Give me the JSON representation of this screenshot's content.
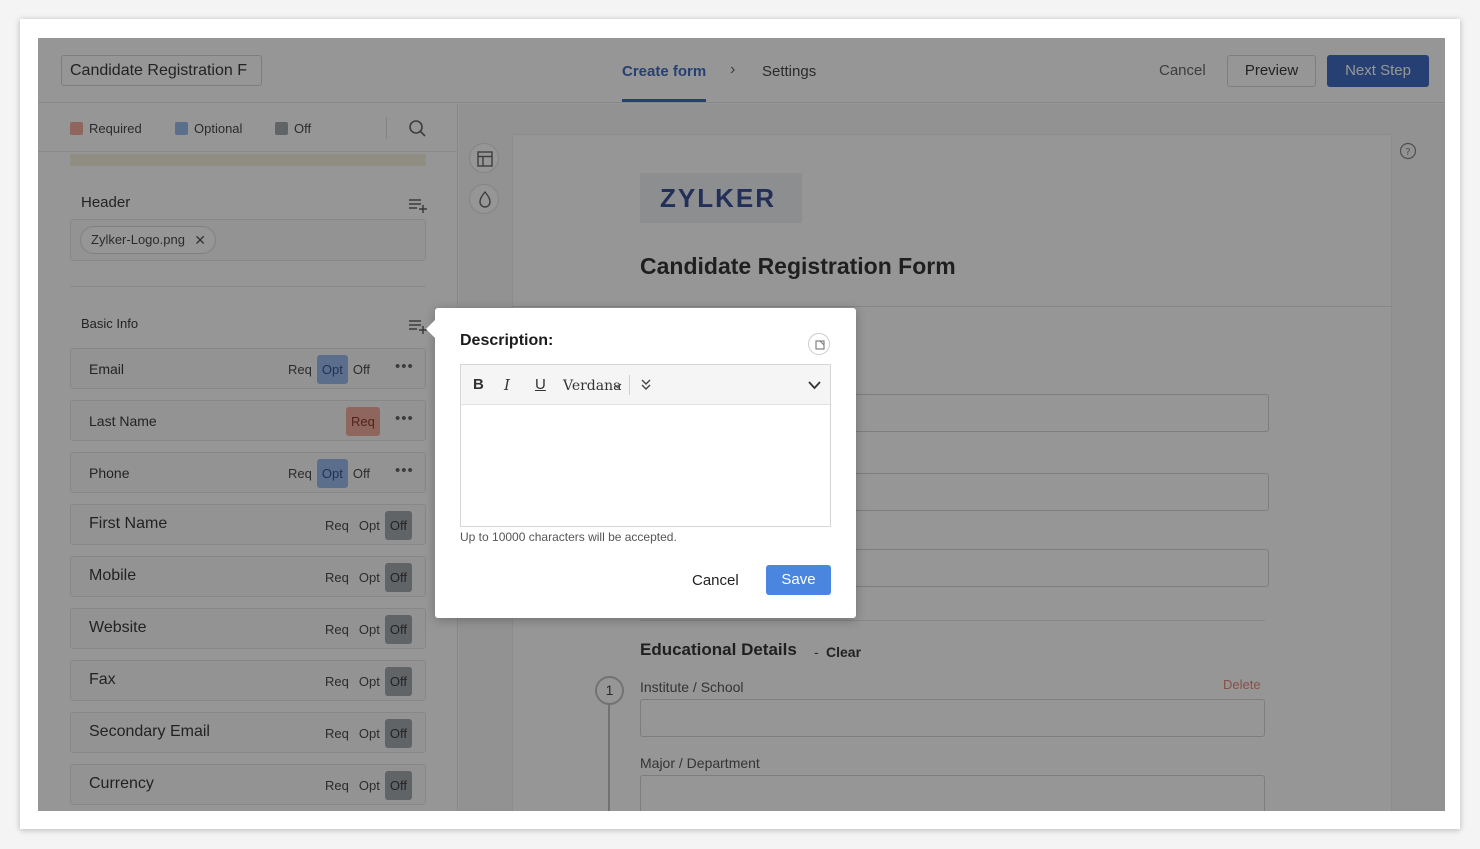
{
  "topbar": {
    "form_name": "Candidate Registration F",
    "step_create": "Create form",
    "step_chevron": "›",
    "step_settings": "Settings",
    "cancel_label": "Cancel",
    "preview_label": "Preview",
    "next_label": "Next Step"
  },
  "legend": {
    "required": "Required",
    "optional": "Optional",
    "off": "Off",
    "colors": {
      "required": "#f1a492",
      "optional": "#8eb3ec",
      "off": "#9aa0a6"
    }
  },
  "header_section": {
    "title": "Header",
    "chip": "Zylker-Logo.png",
    "chip_remove": "✕"
  },
  "basic_info": {
    "title": "Basic Info",
    "fields": [
      {
        "name": "Email",
        "req": "Req",
        "opt": "Opt",
        "off": "Off",
        "state": "opt",
        "more": "•••"
      },
      {
        "name": "Last Name",
        "req": "Req",
        "state": "req",
        "more": "•••"
      },
      {
        "name": "Phone",
        "req": "Req",
        "opt": "Opt",
        "off": "Off",
        "state": "opt",
        "more": "•••"
      },
      {
        "name": "First Name",
        "req": "Req",
        "opt": "Opt",
        "off": "Off",
        "state": "off"
      },
      {
        "name": "Mobile",
        "req": "Req",
        "opt": "Opt",
        "off": "Off",
        "state": "off"
      },
      {
        "name": "Website",
        "req": "Req",
        "opt": "Opt",
        "off": "Off",
        "state": "off"
      },
      {
        "name": "Fax",
        "req": "Req",
        "opt": "Opt",
        "off": "Off",
        "state": "off"
      },
      {
        "name": "Secondary Email",
        "req": "Req",
        "opt": "Opt",
        "off": "Off",
        "state": "off"
      },
      {
        "name": "Currency",
        "req": "Req",
        "opt": "Opt",
        "off": "Off",
        "state": "off"
      }
    ]
  },
  "preview": {
    "logo_text": "ZYLKER",
    "form_title": "Candidate Registration Form",
    "edu_title": "Educational Details",
    "edu_dash": "-",
    "edu_clear": "Clear",
    "step_number": "1",
    "institute_label": "Institute / School",
    "delete_label": "Delete",
    "major_label": "Major / Department"
  },
  "modal": {
    "title": "Description:",
    "font_select": "Verdana",
    "bold": "B",
    "italic": "I",
    "underline": "U",
    "hint": "Up to 10000 characters will be accepted.",
    "cancel_label": "Cancel",
    "save_label": "Save"
  }
}
